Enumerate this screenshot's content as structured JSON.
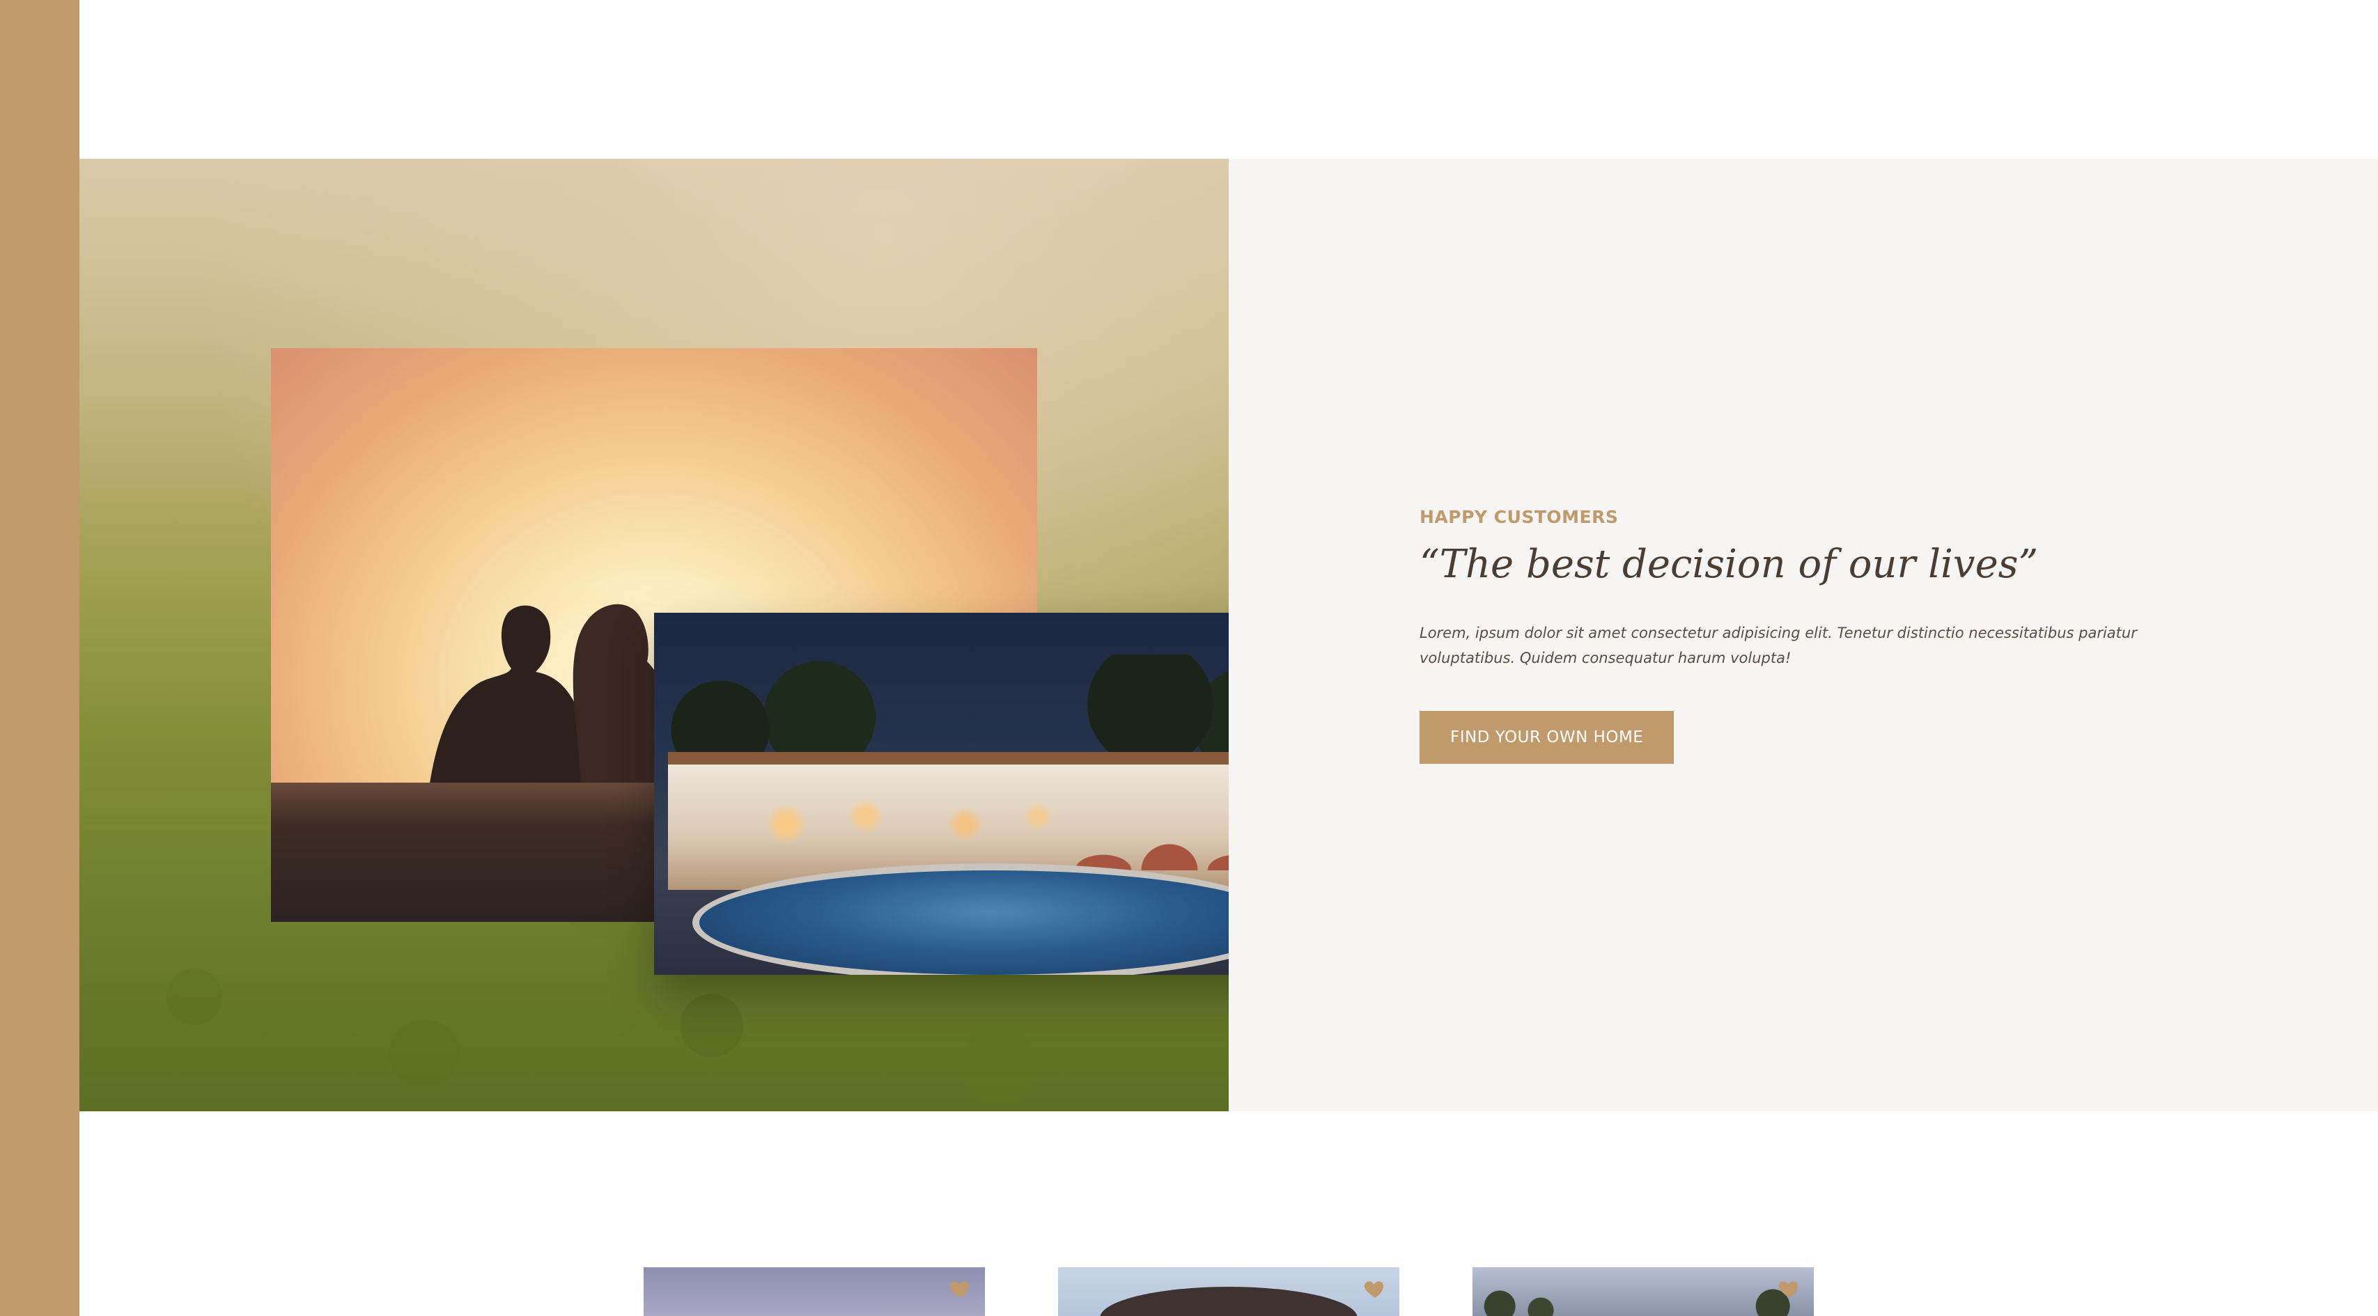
{
  "story": {
    "subtitle": "HAPPY CUSTOMERS",
    "title": "“The best decision of our lives”",
    "body": "Lorem, ipsum dolor sit amet consectetur adipisicing elit. Tenetur distinctio necessitatibus pariatur voluptatibus. Quidem consequatur harum volupta!",
    "button_label": "FIND YOUR OWN HOME"
  },
  "homes": {
    "cards": [
      {
        "favorite_icon": "heart-icon"
      },
      {
        "favorite_icon": "heart-icon"
      },
      {
        "favorite_icon": "heart-icon"
      }
    ]
  },
  "colors": {
    "accent": "#c19a6b",
    "heading": "#4a3d33",
    "text": "#5a4d43",
    "section_bg": "#f7f5f3"
  }
}
